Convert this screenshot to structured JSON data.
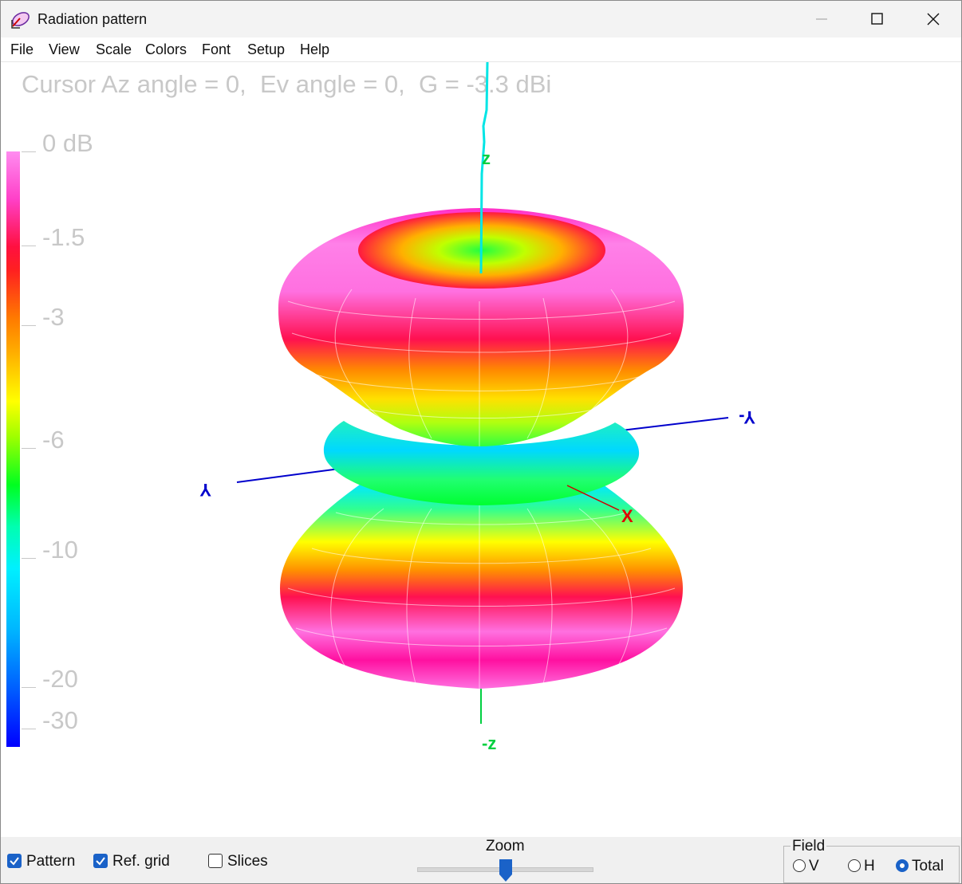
{
  "window": {
    "title": "Radiation pattern",
    "controls": [
      "minimize",
      "maximize",
      "close"
    ]
  },
  "menu": {
    "items": [
      "File",
      "View",
      "Scale",
      "Colors",
      "Font",
      "Setup",
      "Help"
    ]
  },
  "readout": {
    "text": "Cursor Az angle = 0,  Ev angle = 0,  G = -3.3 dBi"
  },
  "colorbar": {
    "labels": [
      "0 dB",
      "-1.5",
      "-3",
      "-6",
      "-10",
      "-20",
      "-30"
    ]
  },
  "axes": {
    "z": "z",
    "neg_z": "-z",
    "y": "Y",
    "neg_y": "Y-",
    "x": "X"
  },
  "bottom": {
    "pattern": {
      "label": "Pattern",
      "checked": true
    },
    "ref_grid": {
      "label": "Ref. grid",
      "checked": true
    },
    "slices": {
      "label": "Slices",
      "checked": false
    },
    "zoom_label": "Zoom",
    "field": {
      "legend": "Field",
      "options": [
        {
          "label": "V",
          "selected": false
        },
        {
          "label": "H",
          "selected": false
        },
        {
          "label": "Total",
          "selected": true
        }
      ]
    }
  },
  "colors": {
    "accent": "#1a62c8",
    "z_axis": "#00e5e5",
    "y_axis": "#0000cc",
    "x_axis": "#e00000"
  }
}
